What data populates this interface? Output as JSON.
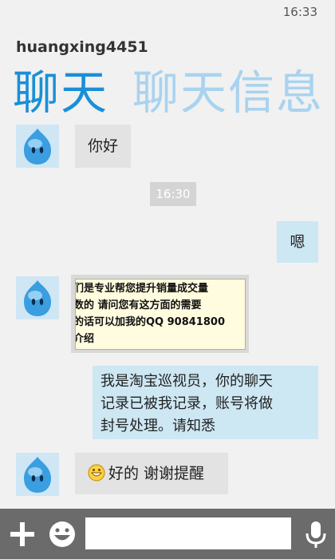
{
  "status": {
    "time": "16:33"
  },
  "header": {
    "contact": "huangxing4451",
    "tabs": [
      {
        "label": "聊天",
        "active": true
      },
      {
        "label": "聊天信息",
        "active": false
      }
    ]
  },
  "messages": {
    "m1": "你好",
    "timestamp": "16:30",
    "m2": "嗯",
    "m3_image_lines": [
      "们是专业帮您提升销量成交量",
      "数的  请问您有这方面的需要",
      "的话可以加我的QQ    90841800",
      "介绍"
    ],
    "m4": "我是淘宝巡视员，你的聊天记录已被我记录，账号将做封号处理。请知悉",
    "m4_lines": [
      "我是淘宝巡视员，你的聊天",
      "记录已被我记录，账号将做",
      "封号处理。请知悉"
    ],
    "m5_emoji": "grinning-face",
    "m5": "好的 谢谢提醒"
  },
  "composer": {
    "placeholder": ""
  },
  "icons": [
    "plus-icon",
    "emoji-icon",
    "microphone-icon",
    "qq-penguin-avatar"
  ],
  "colors": {
    "accent": "#1a8fd6",
    "tab_inactive": "#a9d3ef",
    "bubble_out": "#cde7f3",
    "bubble_in": "#e3e3e3",
    "appbar": "#6b6b6b"
  }
}
